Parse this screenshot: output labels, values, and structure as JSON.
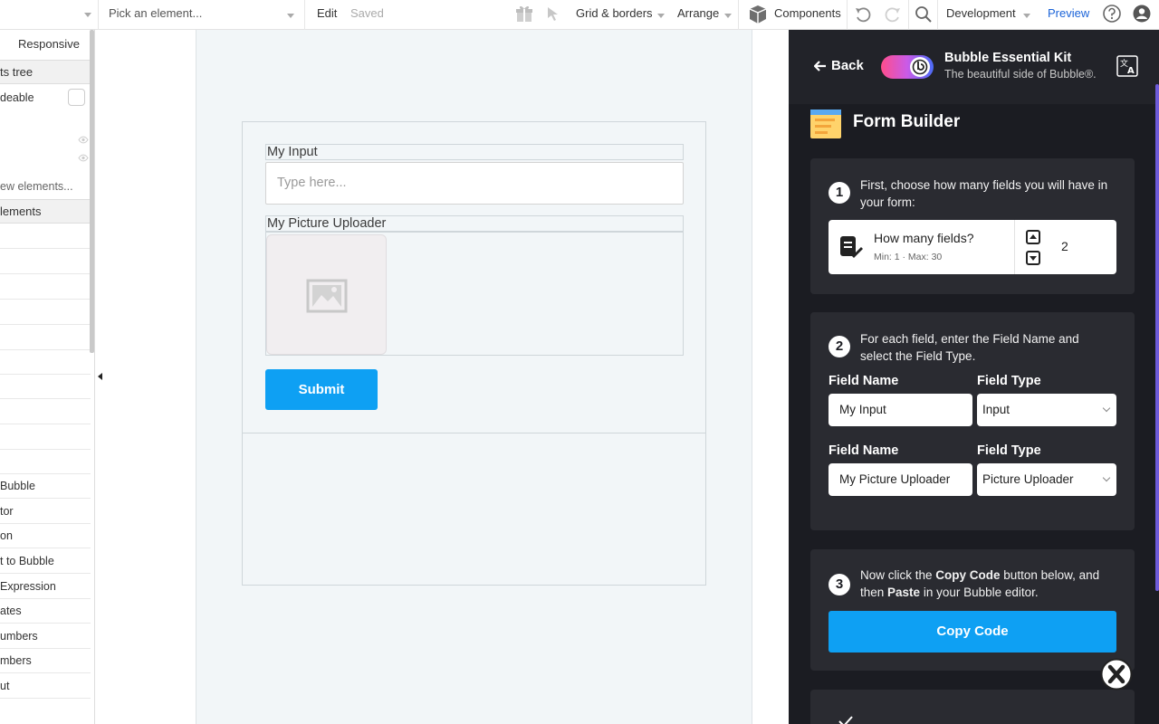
{
  "toolbar": {
    "element_picker_placeholder": "Pick an element...",
    "edit_label": "Edit",
    "saved_label": "Saved",
    "grid_borders_label": "Grid & borders",
    "arrange_label": "Arrange",
    "components_label": "Components",
    "environment_label": "Development",
    "preview_label": "Preview"
  },
  "left_panel": {
    "tab_label": "Responsive",
    "section_elements_tree": "ts tree",
    "upgradeable_label": "deable",
    "search_placeholder": "ew elements...",
    "section_elements": "lements",
    "list_items": [
      "Bubble",
      "tor",
      "on",
      "t to Bubble",
      "Expression",
      "ates",
      "umbers",
      "mbers",
      "ut"
    ]
  },
  "canvas": {
    "input_label": "My Input",
    "input_placeholder": "Type here...",
    "uploader_label": "My Picture Uploader",
    "submit_label": "Submit"
  },
  "plugin": {
    "back_label": "Back",
    "kit_title": "Bubble Essential Kit",
    "kit_subtitle": "The beautiful side of Bubble®.",
    "builder_title": "Form Builder",
    "step1": {
      "number": "1",
      "text": "First, choose how many fields you will have in your form:",
      "question": "How many fields?",
      "range": "Min: 1 · Max: 30",
      "value": "2"
    },
    "step2": {
      "number": "2",
      "text": "For each field, enter the Field Name and select the Field Type.",
      "field_name_header": "Field Name",
      "field_type_header": "Field Type",
      "rows": [
        {
          "name": "My Input",
          "type": "Input"
        },
        {
          "name": "My Picture Uploader",
          "type": "Picture Uploader"
        }
      ]
    },
    "step3": {
      "number": "3",
      "text_prefix": "Now click the ",
      "text_bold1": "Copy Code",
      "text_mid": " button below, and then ",
      "text_bold2": "Paste",
      "text_suffix": " in your Bubble editor.",
      "button_label": "Copy Code"
    }
  },
  "colors": {
    "accent": "#0ea0f3",
    "panel_dark": "#1b1c22",
    "card_dark": "#2a2b31",
    "preview_link": "#1a63d8"
  },
  "icons": [
    "gift-icon",
    "cursor-icon",
    "cube-icon",
    "undo-icon",
    "redo-icon",
    "search-icon",
    "help-icon",
    "user-icon",
    "eye-icon",
    "image-placeholder-icon",
    "arrow-left-icon",
    "translate-icon",
    "form-icon",
    "list-edit-icon",
    "arrow-up-box-icon",
    "arrow-down-box-icon",
    "close-icon",
    "check-icon"
  ]
}
